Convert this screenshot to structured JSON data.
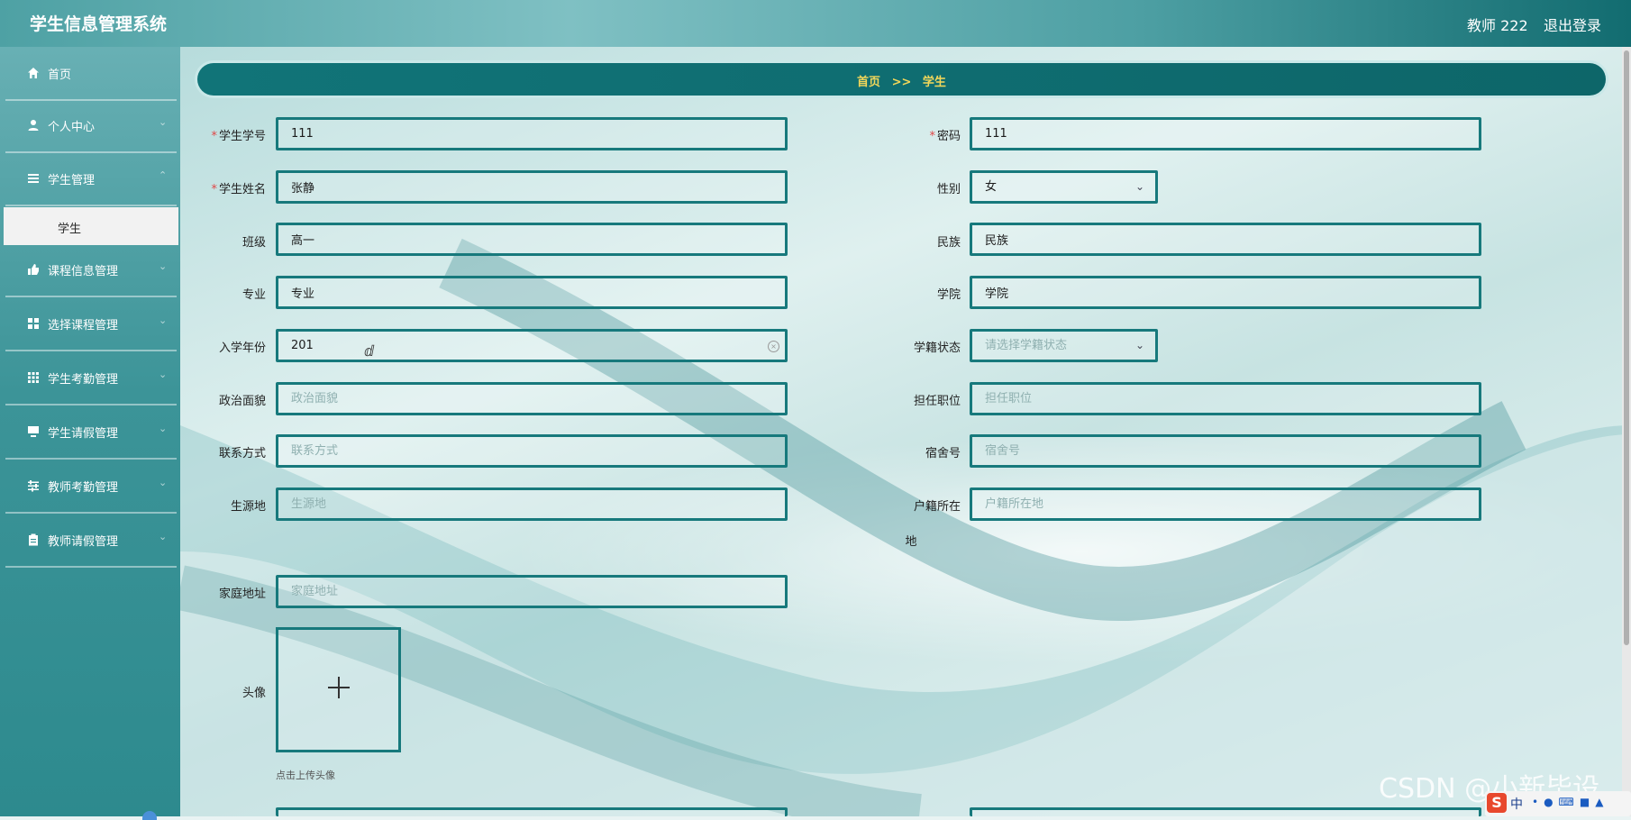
{
  "header": {
    "app_title": "学生信息管理系统",
    "user": "教师 222",
    "logout": "退出登录"
  },
  "sidebar": {
    "items": [
      {
        "label": "首页",
        "icon": "home-icon"
      },
      {
        "label": "个人中心",
        "icon": "user-icon"
      },
      {
        "label": "学生管理",
        "icon": "list-icon"
      },
      {
        "label": "课程信息管理",
        "icon": "thumb-icon"
      },
      {
        "label": "选择课程管理",
        "icon": "grid-icon"
      },
      {
        "label": "学生考勤管理",
        "icon": "grid9-icon"
      },
      {
        "label": "学生请假管理",
        "icon": "monitor-icon"
      },
      {
        "label": "教师考勤管理",
        "icon": "sliders-icon"
      },
      {
        "label": "教师请假管理",
        "icon": "clipboard-icon"
      }
    ],
    "active_sub": "学生"
  },
  "breadcrumb": {
    "home": "首页",
    "sep": ">>",
    "current": "学生"
  },
  "form": {
    "student_no": {
      "label": "学生学号",
      "value": "111"
    },
    "password": {
      "label": "密码",
      "value": "111"
    },
    "student_name": {
      "label": "学生姓名",
      "value": "张静"
    },
    "gender": {
      "label": "性别",
      "value": "女"
    },
    "class": {
      "label": "班级",
      "value": "高一"
    },
    "ethnicity": {
      "label": "民族",
      "value": "民族"
    },
    "major": {
      "label": "专业",
      "value": "专业"
    },
    "college": {
      "label": "学院",
      "value": "学院"
    },
    "enroll_year": {
      "label": "入学年份",
      "value": "201"
    },
    "status": {
      "label": "学籍状态",
      "placeholder": "请选择学籍状态"
    },
    "political": {
      "label": "政治面貌",
      "placeholder": "政治面貌"
    },
    "position": {
      "label": "担任职位",
      "placeholder": "担任职位"
    },
    "contact": {
      "label": "联系方式",
      "placeholder": "联系方式"
    },
    "dorm": {
      "label": "宿舍号",
      "placeholder": "宿舍号"
    },
    "origin": {
      "label": "生源地",
      "placeholder": "生源地"
    },
    "household_line1": "户籍所在",
    "household_line2": "地",
    "household_placeholder": "户籍所在地",
    "address": {
      "label": "家庭地址",
      "placeholder": "家庭地址"
    },
    "avatar": {
      "label": "头像",
      "hint": "点击上传头像"
    }
  },
  "watermark": "CSDN @小新毕设",
  "ime": {
    "logo": "S",
    "mode": "中"
  }
}
